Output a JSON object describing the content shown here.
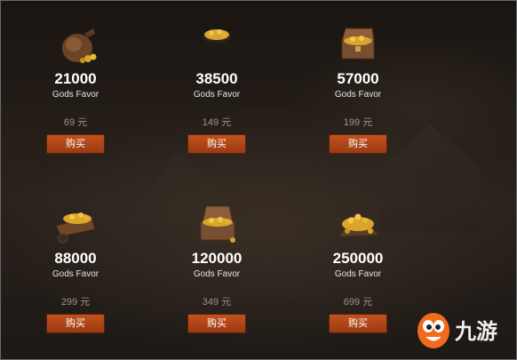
{
  "store": {
    "items": [
      {
        "amount": "21000",
        "label": "Gods Favor",
        "price": "69 元",
        "buy": "购买",
        "icon": "money-bag-icon"
      },
      {
        "amount": "38500",
        "label": "Gods Favor",
        "price": "149 元",
        "buy": "购买",
        "icon": "gold-pot-icon"
      },
      {
        "amount": "57000",
        "label": "Gods Favor",
        "price": "199 元",
        "buy": "购买",
        "icon": "treasure-chest-icon"
      },
      {
        "amount": "88000",
        "label": "Gods Favor",
        "price": "299 元",
        "buy": "购买",
        "icon": "gold-cart-icon"
      },
      {
        "amount": "120000",
        "label": "Gods Favor",
        "price": "349 元",
        "buy": "购买",
        "icon": "large-treasure-chest-icon"
      },
      {
        "amount": "250000",
        "label": "Gods Favor",
        "price": "699 元",
        "buy": "购买",
        "icon": "gold-pile-icon"
      }
    ]
  },
  "watermark": {
    "text": "九游",
    "icon": "jiuyou-mascot-icon"
  }
}
